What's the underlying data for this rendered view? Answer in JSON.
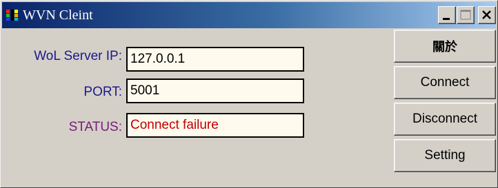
{
  "window": {
    "title": "WVN Cleint",
    "icon": "app-icon"
  },
  "titlebar_buttons": {
    "minimize_icon": "minimize-icon",
    "maximize_icon": "maximize-icon",
    "close_icon": "close-icon"
  },
  "form": {
    "server_ip": {
      "label": "WoL Server IP:",
      "value": "127.0.0.1"
    },
    "port": {
      "label": "PORT:",
      "value": "5001"
    },
    "status": {
      "label": "STATUS:",
      "value": "Connect failure",
      "color": "#c00000"
    }
  },
  "buttons": {
    "about": "關於",
    "connect": "Connect",
    "disconnect": "Disconnect",
    "setting": "Setting"
  },
  "colors": {
    "title_bar_start": "#0a246a",
    "title_bar_end": "#a6caf0",
    "field_background": "#fffaee",
    "label_blue": "#1a1a8c",
    "label_purple": "#7a1a7a"
  }
}
